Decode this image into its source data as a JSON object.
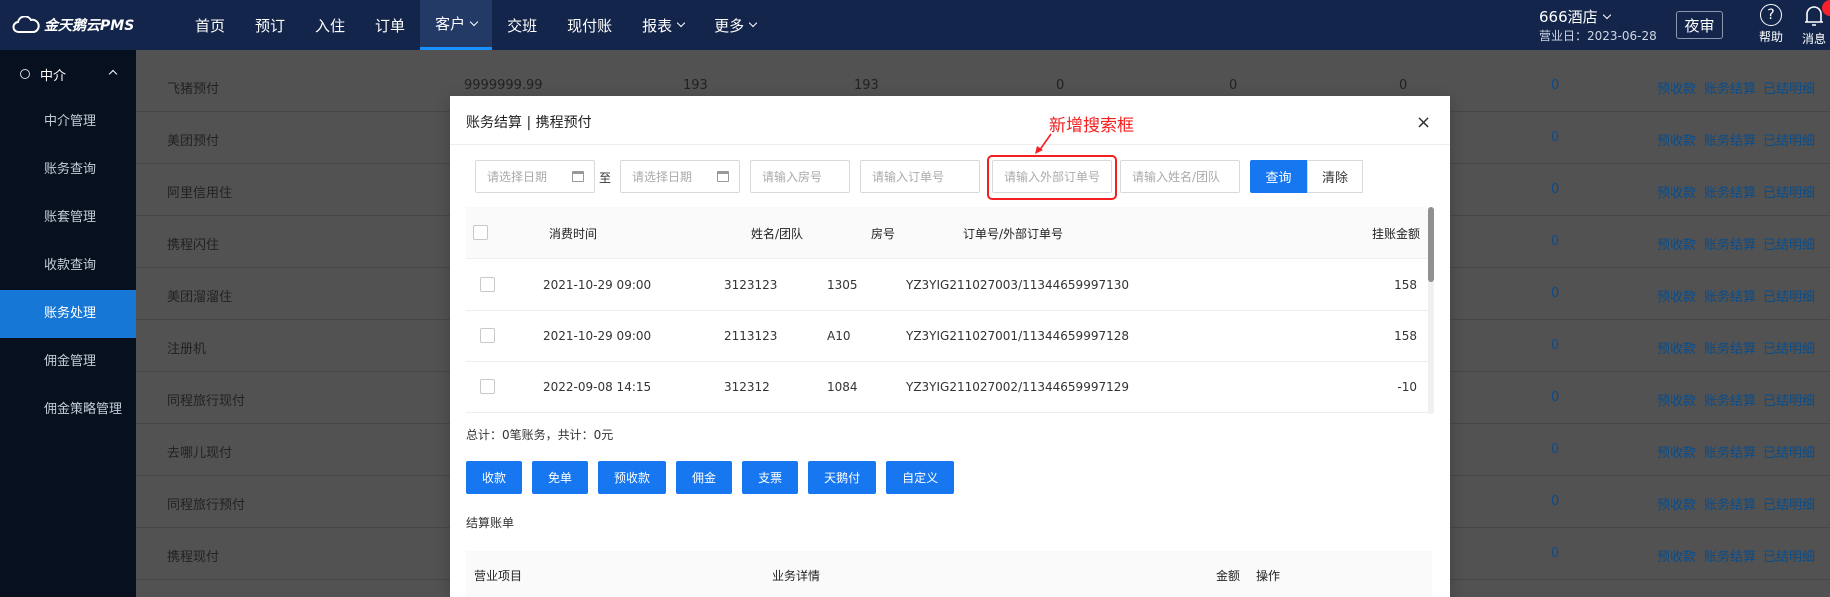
{
  "logo": {
    "text": "金天鹅云PMS"
  },
  "nav": {
    "items": [
      {
        "label": "首页",
        "dropdown": false,
        "active": false
      },
      {
        "label": "预订",
        "dropdown": false,
        "active": false
      },
      {
        "label": "入住",
        "dropdown": false,
        "active": false
      },
      {
        "label": "订单",
        "dropdown": false,
        "active": false
      },
      {
        "label": "客户",
        "dropdown": true,
        "active": true
      },
      {
        "label": "交班",
        "dropdown": false,
        "active": false
      },
      {
        "label": "现付账",
        "dropdown": false,
        "active": false
      },
      {
        "label": "报表",
        "dropdown": true,
        "active": false
      },
      {
        "label": "更多",
        "dropdown": true,
        "active": false
      }
    ]
  },
  "header": {
    "hotel": "666酒店",
    "business_date": "营业日：2023-06-28",
    "night_audit": "夜审",
    "help": "帮助",
    "messages": "消息"
  },
  "sidebar": {
    "section": "中介",
    "items": [
      {
        "label": "中介管理",
        "active": false
      },
      {
        "label": "账务查询",
        "active": false
      },
      {
        "label": "账套管理",
        "active": false
      },
      {
        "label": "收款查询",
        "active": false
      },
      {
        "label": "账务处理",
        "active": true
      },
      {
        "label": "佣金管理",
        "active": false
      },
      {
        "label": "佣金策略管理",
        "active": false
      }
    ]
  },
  "background_table": {
    "rows": [
      {
        "name": "飞猪预付",
        "limit": "9999999.99",
        "v1": "193",
        "v2": "193",
        "v3": "0",
        "v4": "0",
        "v5": "0",
        "v6": "0"
      },
      {
        "name": "美团预付",
        "limit": "",
        "v1": "",
        "v2": "",
        "v3": "",
        "v4": "",
        "v5": "",
        "v6": "0"
      },
      {
        "name": "阿里信用住",
        "limit": "",
        "v1": "",
        "v2": "",
        "v3": "",
        "v4": "",
        "v5": "",
        "v6": "0"
      },
      {
        "name": "携程闪住",
        "limit": "",
        "v1": "",
        "v2": "",
        "v3": "",
        "v4": "",
        "v5": "",
        "v6": "0"
      },
      {
        "name": "美团溜溜住",
        "limit": "",
        "v1": "",
        "v2": "",
        "v3": "",
        "v4": "",
        "v5": "",
        "v6": "0"
      },
      {
        "name": "注册机",
        "limit": "",
        "v1": "",
        "v2": "",
        "v3": "",
        "v4": "",
        "v5": "",
        "v6": "0"
      },
      {
        "name": "同程旅行现付",
        "limit": "",
        "v1": "",
        "v2": "",
        "v3": "",
        "v4": "",
        "v5": "",
        "v6": "0"
      },
      {
        "name": "去哪儿现付",
        "limit": "",
        "v1": "",
        "v2": "",
        "v3": "",
        "v4": "",
        "v5": "",
        "v6": "0"
      },
      {
        "name": "同程旅行预付",
        "limit": "",
        "v1": "",
        "v2": "",
        "v3": "",
        "v4": "",
        "v5": "",
        "v6": "0"
      },
      {
        "name": "携程现付",
        "limit": "",
        "v1": "",
        "v2": "",
        "v3": "",
        "v4": "",
        "v5": "",
        "v6": "0"
      }
    ],
    "actions": [
      "预收款",
      "账务结算",
      "已结明细"
    ]
  },
  "modal": {
    "title": "账务结算 | 携程预付",
    "close": "×",
    "filters": {
      "start_date": "请选择日期",
      "to": "至",
      "end_date": "请选择日期",
      "room_no": "请输入房号",
      "order_no": "请输入订单号",
      "ext_order_no": "请输入外部订单号",
      "name_team": "请输入姓名/团队",
      "query": "查询",
      "clear": "清除"
    },
    "annotation": "新增搜索框",
    "table": {
      "headers": [
        "消费时间",
        "姓名/团队",
        "房号",
        "订单号/外部订单号",
        "挂账金额"
      ],
      "rows": [
        {
          "time": "2021-10-29 09:00",
          "name": "3123123",
          "room": "1305",
          "order": "YZ3YIG211027003/11344659997130",
          "amount": "158"
        },
        {
          "time": "2021-10-29 09:00",
          "name": "2113123",
          "room": "A10",
          "order": "YZ3YIG211027001/11344659997128",
          "amount": "158"
        },
        {
          "time": "2022-09-08 14:15",
          "name": "312312",
          "room": "1084",
          "order": "YZ3YIG211027002/11344659997129",
          "amount": "-10"
        }
      ]
    },
    "total": "总计：0笔账务，共计：0元",
    "buttons": [
      "收款",
      "免单",
      "预收款",
      "佣金",
      "支票",
      "天鹅付",
      "自定义"
    ],
    "settle_label": "结算账单",
    "settle_headers": [
      "营业项目",
      "业务详情",
      "金额",
      "操作"
    ]
  }
}
